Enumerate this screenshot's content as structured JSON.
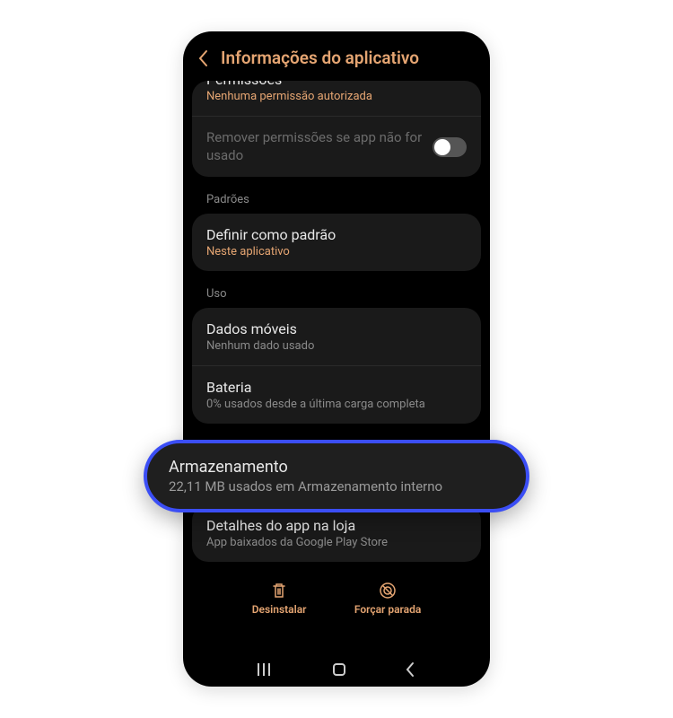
{
  "header": {
    "title": "Informações do aplicativo"
  },
  "permissions": {
    "title_cut": "Permissões",
    "subtitle": "Nenhuma permissão autorizada",
    "remove_label": "Remover permissões se app não for usado"
  },
  "sections": {
    "defaults_label": "Padrões",
    "usage_label": "Uso"
  },
  "defaults": {
    "title": "Definir como padrão",
    "subtitle": "Neste aplicativo"
  },
  "usage": {
    "mobile_data": {
      "title": "Dados móveis",
      "subtitle": "Nenhum dado usado"
    },
    "battery": {
      "title": "Bateria",
      "subtitle": "0% usados desde a última carga completa"
    }
  },
  "storage": {
    "title": "Armazenamento",
    "subtitle": "22,11 MB usados em Armazenamento interno"
  },
  "store": {
    "title": "Detalhes do app na loja",
    "subtitle": "App baixados da Google Play Store"
  },
  "actions": {
    "uninstall": "Desinstalar",
    "force_stop": "Forçar parada"
  }
}
